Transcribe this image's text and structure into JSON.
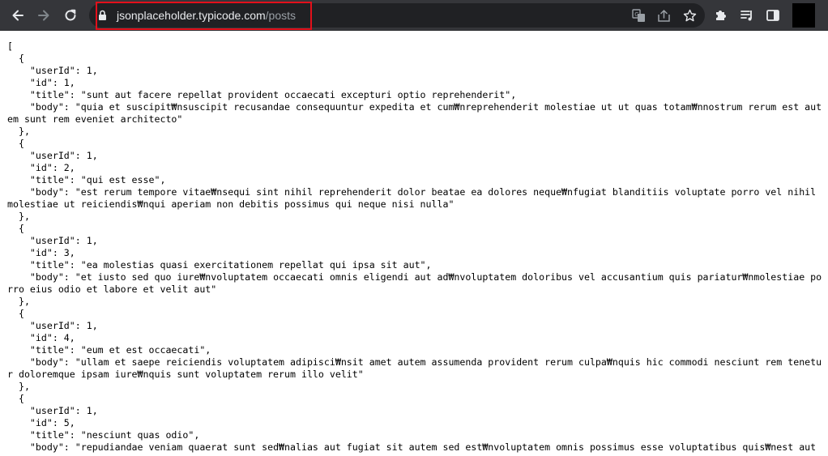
{
  "browser": {
    "url_host": "jsonplaceholder.typicode.com",
    "url_path": "/posts",
    "icons": {
      "back": "back-arrow-icon",
      "forward": "forward-arrow-icon",
      "reload": "reload-icon",
      "lock": "lock-icon",
      "translate": "translate-icon",
      "share": "share-icon",
      "bookmark": "star-icon",
      "extensions": "puzzle-icon",
      "reading_list": "reading-list-icon",
      "side_panel": "side-panel-icon"
    },
    "colors": {
      "toolbar": "#35363a",
      "omnibox": "#202124",
      "highlight": "#e3101b"
    }
  },
  "page": {
    "json_text": "[\n  {\n    \"userId\": 1,\n    \"id\": 1,\n    \"title\": \"sunt aut facere repellat provident occaecati excepturi optio reprehenderit\",\n    \"body\": \"quia et suscipit₩nsuscipit recusandae consequuntur expedita et cum₩nreprehenderit molestiae ut ut quas totam₩nnostrum rerum est autem sunt rem eveniet architecto\"\n  },\n  {\n    \"userId\": 1,\n    \"id\": 2,\n    \"title\": \"qui est esse\",\n    \"body\": \"est rerum tempore vitae₩nsequi sint nihil reprehenderit dolor beatae ea dolores neque₩nfugiat blanditiis voluptate porro vel nihil molestiae ut reiciendis₩nqui aperiam non debitis possimus qui neque nisi nulla\"\n  },\n  {\n    \"userId\": 1,\n    \"id\": 3,\n    \"title\": \"ea molestias quasi exercitationem repellat qui ipsa sit aut\",\n    \"body\": \"et iusto sed quo iure₩nvoluptatem occaecati omnis eligendi aut ad₩nvoluptatem doloribus vel accusantium quis pariatur₩nmolestiae porro eius odio et labore et velit aut\"\n  },\n  {\n    \"userId\": 1,\n    \"id\": 4,\n    \"title\": \"eum et est occaecati\",\n    \"body\": \"ullam et saepe reiciendis voluptatem adipisci₩nsit amet autem assumenda provident rerum culpa₩nquis hic commodi nesciunt rem tenetur doloremque ipsam iure₩nquis sunt voluptatem rerum illo velit\"\n  },\n  {\n    \"userId\": 1,\n    \"id\": 5,\n    \"title\": \"nesciunt quas odio\",\n    \"body\": \"repudiandae veniam quaerat sunt sed₩nalias aut fugiat sit autem sed est₩nvoluptatem omnis possimus esse voluptatibus quis₩nest aut"
  }
}
